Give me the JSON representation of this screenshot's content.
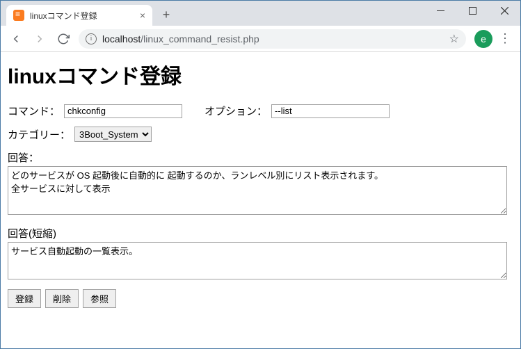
{
  "chrome": {
    "tab_title": "linuxコマンド登録",
    "url_host": "localhost",
    "url_path": "/linux_command_resist.php",
    "avatar_letter": "e"
  },
  "page": {
    "heading": "linuxコマンド登録",
    "labels": {
      "command": "コマンド：",
      "option": "オプション：",
      "category": "カテゴリー：",
      "answer": "回答：",
      "answer_short": "回答(短縮)"
    },
    "form": {
      "command_value": "chkconfig",
      "option_value": "--list",
      "category_selected": "3Boot_System",
      "answer_value": "どのサービスが OS 起動後に自動的に 起動するのか、ランレベル別にリスト表示されます。\n全サービスに対して表示",
      "answer_short_value": "サービス自動起動の一覧表示。"
    },
    "buttons": {
      "register": "登録",
      "delete": "削除",
      "reference": "参照"
    }
  }
}
